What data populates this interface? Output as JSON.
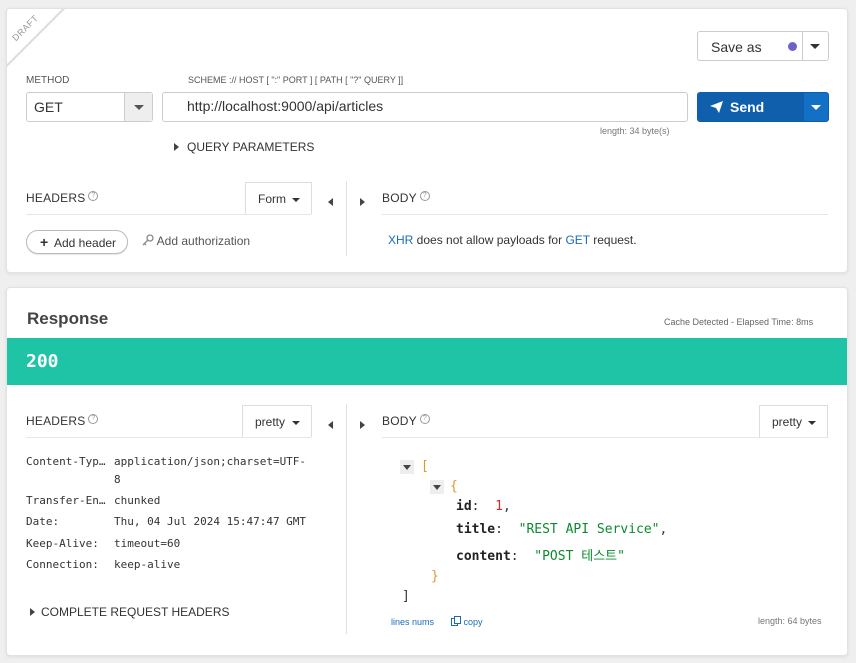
{
  "request": {
    "draft_label": "DRAFT",
    "save_as_label": "Save as",
    "method_label": "METHOD",
    "method_value": "GET",
    "url_hint": "SCHEME :// HOST [ \":\" PORT ] [ PATH [ \"?\" QUERY ]]",
    "url_value": "http://localhost:9000/api/articles",
    "url_length": "length: 34 byte(s)",
    "send_label": "Send",
    "query_params_label": "QUERY PARAMETERS",
    "headers_label": "HEADERS",
    "headers_mode": "Form",
    "body_label": "BODY",
    "add_header_label": "Add header",
    "add_auth_label": "Add authorization",
    "body_note": {
      "xhr": "XHR",
      "middle": " does not allow payloads for ",
      "method": "GET",
      "end": " request."
    }
  },
  "response": {
    "title": "Response",
    "cache_note": "Cache Detected - Elapsed Time: 8ms",
    "status_code": "200",
    "headers_label": "HEADERS",
    "headers_mode": "pretty",
    "body_label": "BODY",
    "body_mode": "pretty",
    "headers": [
      {
        "name": "Content-Typ…",
        "value": "application/json;charset=UTF-",
        "value2": "8"
      },
      {
        "name": "Transfer-En…",
        "value": "chunked"
      },
      {
        "name": "Date:",
        "value": "Thu, 04 Jul 2024 15:47:47 GMT"
      },
      {
        "name": "Keep-Alive:",
        "value": "timeout=60"
      },
      {
        "name": "Connection:",
        "value": "keep-alive"
      }
    ],
    "complete_headers_label": "COMPLETE REQUEST HEADERS",
    "json": {
      "open_array": "[",
      "open_obj": "{",
      "id_key": "id",
      "id_value": "1",
      "title_key": "title",
      "title_value": "\"REST API Service\"",
      "content_key": "content",
      "content_value": "\"POST 테스트\"",
      "close_obj": "}",
      "close_array": "]"
    },
    "lines_nums_label": "lines nums",
    "copy_label": "copy",
    "body_length": "length: 64 bytes"
  },
  "colors": {
    "status_bar": "#1ec4a5",
    "send_button": "#0f5fad",
    "link": "#1c6bb8"
  }
}
